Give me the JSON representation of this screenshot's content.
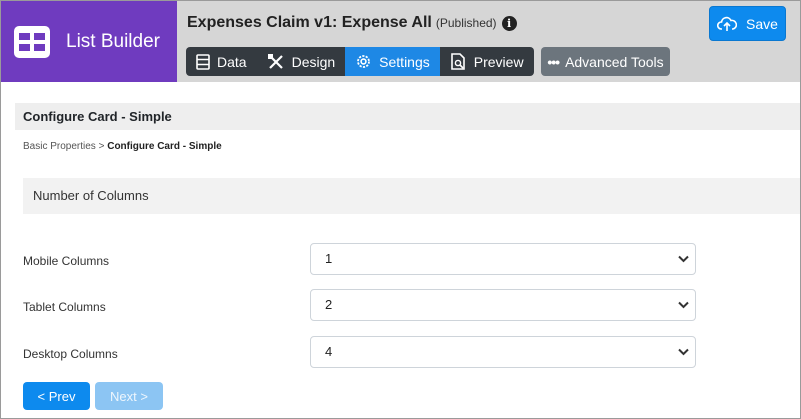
{
  "brand": {
    "title": "List Builder",
    "color": "#6f3bbf"
  },
  "header": {
    "title": "Expenses Claim v1: Expense All",
    "status": "(Published)",
    "info_icon": "info-icon"
  },
  "tabs": [
    {
      "label": "Data",
      "icon": "table-icon",
      "active": false
    },
    {
      "label": "Design",
      "icon": "design-tools-icon",
      "active": false
    },
    {
      "label": "Settings",
      "icon": "gear-icon",
      "active": true
    },
    {
      "label": "Preview",
      "icon": "document-search-icon",
      "active": false
    }
  ],
  "advanced_tools": {
    "label": "Advanced Tools",
    "icon": "more-dots-icon"
  },
  "save": {
    "label": "Save",
    "icon": "cloud-upload-icon"
  },
  "section": {
    "title": "Configure Card - Simple"
  },
  "breadcrumb": {
    "parent": "Basic Properties",
    "separator": ">",
    "current": "Configure Card - Simple"
  },
  "panel": {
    "title": "Number of Columns"
  },
  "fields": [
    {
      "label": "Mobile Columns",
      "value": "1"
    },
    {
      "label": "Tablet Columns",
      "value": "2"
    },
    {
      "label": "Desktop Columns",
      "value": "4"
    }
  ],
  "nav": {
    "prev_label": "< Prev",
    "next_label": "Next >"
  },
  "colors": {
    "accent": "#0d8aee",
    "tab_bar": "#343a40",
    "active_tab": "#1e88e5"
  }
}
